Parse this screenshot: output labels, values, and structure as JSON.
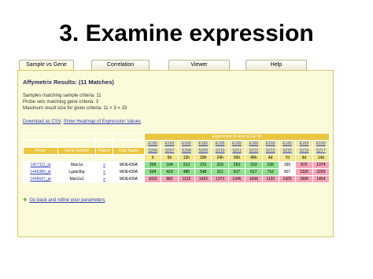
{
  "slide_title": "3. Examine expression",
  "tabs": [
    {
      "label": "Sample vs Gene",
      "active": true
    },
    {
      "label": "Correlation",
      "active": false
    },
    {
      "label": "Viewer",
      "active": false
    },
    {
      "label": "Help",
      "active": false
    }
  ],
  "results": {
    "title": "Affymetrix Results: (11 Matches)",
    "info": [
      "Samples matching sample criteria: 11",
      "Probe sets matching gene criteria: 3",
      "Maximum result size for given criteria: 11 × 3 = 33"
    ],
    "download_csv": "Download as CSV",
    "separator": ", ",
    "show_heatmap": "Show Heatmap of Expression Values"
  },
  "table": {
    "experiment_header": "Experiment ID and SCGP ID",
    "column_headers": {
      "probe": "Probe",
      "gene_symbol": "Gene Symbol",
      "pattern": "Pattern",
      "chip_name": "Chip Name"
    },
    "experiment_ids": [
      "E165",
      "E165",
      "E165",
      "E165",
      "E165",
      "E165",
      "E165",
      "E165",
      "E165",
      "E165",
      "E165"
    ],
    "sample_ids": [
      "S206",
      "S207",
      "S208",
      "S209",
      "S210",
      "S211",
      "S212",
      "S213",
      "S215",
      "S216",
      "S217"
    ],
    "timepoints": [
      "0",
      "6h",
      "12h",
      "18h",
      "24h",
      "36h",
      "48h",
      "4d",
      "7d",
      "9d",
      "14d"
    ],
    "rows": [
      {
        "probe": "1417111_at",
        "gene": "Man1a",
        "pattern": "x",
        "chip": "MOE430A",
        "values": [
          "209",
          "164",
          "213",
          "231",
          "219",
          "253",
          "233",
          "236",
          "395",
          "872",
          "1074"
        ],
        "colors": [
          "#8fe08f",
          "#8fe08f",
          "#8fe08f",
          "#8fe08f",
          "#8fe08f",
          "#8fe08f",
          "#8fe08f",
          "#8fe08f",
          "#ffffff",
          "#f5a7b8",
          "#f5a7b8"
        ]
      },
      {
        "probe": "1446380_at",
        "gene": "Lgals3bp",
        "pattern": "x",
        "chip": "MOE430A",
        "values": [
          "634",
          "419",
          "486",
          "548",
          "311",
          "617",
          "617",
          "716",
          "907",
          "1320",
          "2293"
        ],
        "colors": [
          "#8fe08f",
          "#8fe08f",
          "#8fe08f",
          "#8fe08f",
          "#8fe08f",
          "#8fe08f",
          "#8fe08f",
          "#8fe08f",
          "#ffffff",
          "#f5a7b8",
          "#f5a7b8"
        ]
      },
      {
        "probe": "1449647_at",
        "gene": "Man2a1",
        "pattern": "x",
        "chip": "MOE430A",
        "values": [
          "1032",
          "882",
          "1123",
          "1423",
          "1372",
          "1345",
          "1606",
          "1133",
          "1425",
          "1506",
          "1454"
        ],
        "colors": [
          "#f5a7b8",
          "#f5a7b8",
          "#f5a7b8",
          "#f5a7b8",
          "#f5a7b8",
          "#f5a7b8",
          "#f5a7b8",
          "#f5a7b8",
          "#f5a7b8",
          "#f5a7b8",
          "#f5a7b8"
        ]
      }
    ]
  },
  "back_link": "Go back and refine your parameters"
}
